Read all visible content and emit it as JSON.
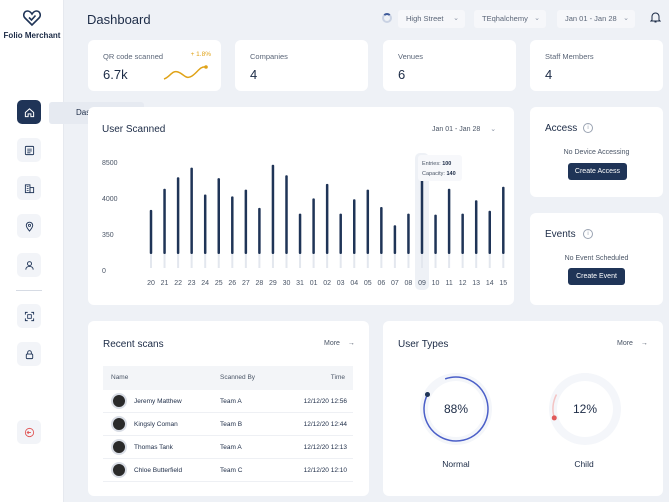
{
  "app": {
    "brand": "Folio Merchant",
    "page_title": "Dashboard"
  },
  "sidebar": {
    "tooltip": "Dashboard",
    "items": [
      {
        "icon": "home-icon"
      },
      {
        "icon": "list-icon"
      },
      {
        "icon": "building-icon"
      },
      {
        "icon": "location-pin-icon"
      },
      {
        "icon": "user-icon"
      },
      {
        "icon": "qr-scan-icon"
      },
      {
        "icon": "lock-icon"
      },
      {
        "icon": "logout-icon"
      }
    ]
  },
  "topbar": {
    "venue": "High Street",
    "company": "TEqhalchemy",
    "date_range": "Jan 01 - Jan 28"
  },
  "stats": [
    {
      "label": "QR code scanned",
      "value": "6.7k",
      "delta": "+ 1.8%"
    },
    {
      "label": "Companies",
      "value": "4"
    },
    {
      "label": "Venues",
      "value": "6"
    },
    {
      "label": "Staff Members",
      "value": "4"
    }
  ],
  "user_scanned": {
    "title": "User Scanned",
    "date_range": "Jan 01 - Jan 28",
    "tooltip": {
      "entries_label": "Entries:",
      "entries": "100",
      "capacity_label": "Capacity:",
      "capacity": "140"
    }
  },
  "chart_data": {
    "type": "bar",
    "title": "User Scanned",
    "y_tick_labels": [
      "8500",
      "4000",
      "350",
      "0"
    ],
    "categories": [
      "20",
      "21",
      "22",
      "23",
      "24",
      "25",
      "26",
      "27",
      "28",
      "29",
      "30",
      "31",
      "01",
      "02",
      "03",
      "04",
      "05",
      "06",
      "07",
      "08",
      "09",
      "10",
      "11",
      "12",
      "13",
      "14",
      "15"
    ],
    "values": [
      0.46,
      0.68,
      0.8,
      0.9,
      0.62,
      0.79,
      0.6,
      0.67,
      0.48,
      0.93,
      0.82,
      0.42,
      0.58,
      0.73,
      0.42,
      0.57,
      0.67,
      0.49,
      0.3,
      0.42,
      0.91,
      0.41,
      0.68,
      0.42,
      0.56,
      0.45,
      0.7
    ],
    "value_scale": "fraction of plot height (axis tick values are non-linear)",
    "highlighted_category": "09"
  },
  "access": {
    "title": "Access",
    "empty_text": "No Device Accessing",
    "button": "Create Access"
  },
  "events": {
    "title": "Events",
    "empty_text": "No Event Scheduled",
    "button": "Create Event"
  },
  "recent_scans": {
    "title": "Recent scans",
    "more": "More",
    "columns": [
      "Name",
      "Scanned By",
      "Time"
    ],
    "rows": [
      {
        "name": "Jeremy Matthew",
        "team": "Team A",
        "time": "12/12/20 12:56"
      },
      {
        "name": "Kingsly Coman",
        "team": "Team B",
        "time": "12/12/20 12:44"
      },
      {
        "name": "Thomas Tank",
        "team": "Team A",
        "time": "12/12/20 12:13"
      },
      {
        "name": "Chloe Butterfield",
        "team": "Team C",
        "time": "12/12/20 12:10"
      }
    ]
  },
  "user_types": {
    "title": "User Types",
    "more": "More",
    "types": [
      {
        "label": "Normal",
        "percent_text": "88%",
        "percent": 88
      },
      {
        "label": "Child",
        "percent_text": "12%",
        "percent": 12
      }
    ]
  },
  "colors": {
    "primary": "#1f3457",
    "accent": "#e0a318",
    "bar": "#1f3457",
    "danger": "#e05a5a"
  }
}
